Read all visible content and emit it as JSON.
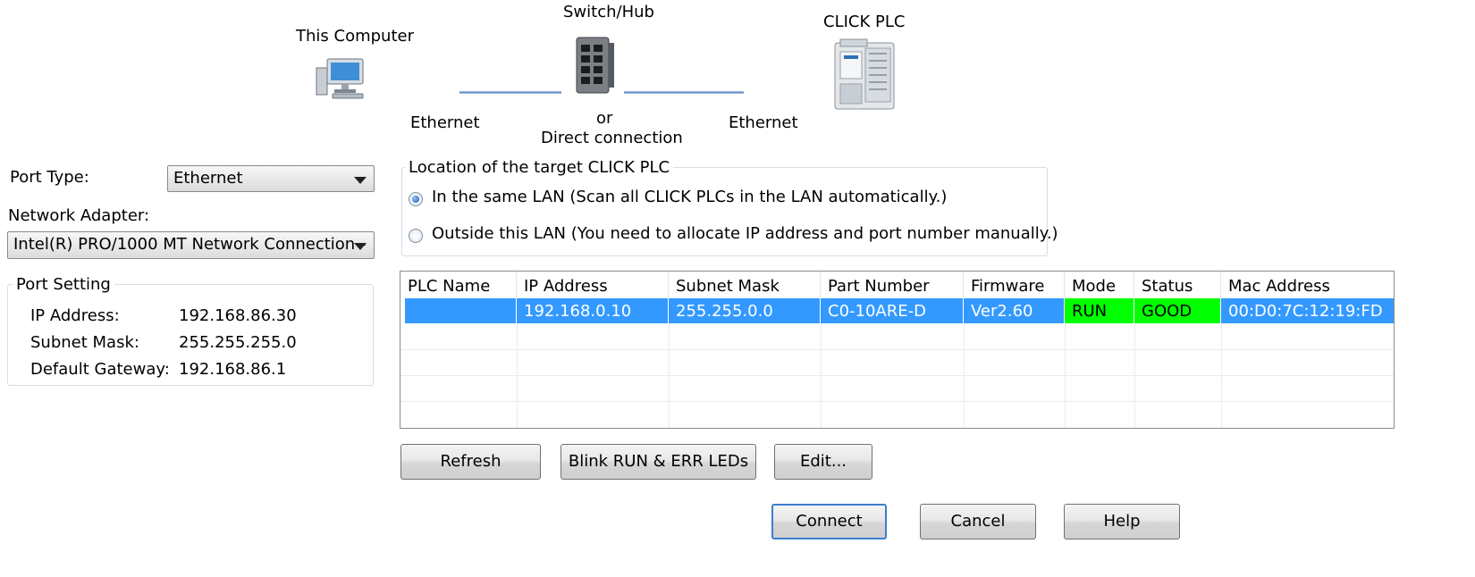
{
  "diagram": {
    "computer_label": "This Computer",
    "switch_label": "Switch/Hub",
    "plc_label": "CLICK PLC",
    "ethernet_left": "Ethernet",
    "ethernet_right": "Ethernet",
    "or_label": "or",
    "direct_label": "Direct connection"
  },
  "port": {
    "type_label": "Port Type:",
    "type_value": "Ethernet",
    "adapter_label": "Network Adapter:",
    "adapter_value": "Intel(R) PRO/1000 MT Network Connection -"
  },
  "port_setting": {
    "title": "Port Setting",
    "ip_label": "IP Address:",
    "ip_value": "192.168.86.30",
    "mask_label": "Subnet Mask:",
    "mask_value": "255.255.255.0",
    "gateway_label": "Default Gateway:",
    "gateway_value": "192.168.86.1"
  },
  "location": {
    "title": "Location of the target CLICK PLC",
    "option_same_lan": "In the same LAN (Scan all CLICK PLCs in the LAN automatically.)",
    "option_outside_lan": "Outside this LAN (You need to allocate IP address and port number manually.)",
    "selected": "same_lan"
  },
  "plc_table": {
    "headers": [
      "PLC Name",
      "IP Address",
      "Subnet Mask",
      "Part Number",
      "Firmware",
      "Mode",
      "Status",
      "Mac Address"
    ],
    "rows": [
      {
        "plc_name": "",
        "ip_address": "192.168.0.10",
        "subnet_mask": "255.255.0.0",
        "part_number": "C0-10ARE-D",
        "firmware": "Ver2.60",
        "mode": "RUN",
        "status": "GOOD",
        "mac_address": "00:D0:7C:12:19:FD"
      }
    ]
  },
  "actions": {
    "refresh": "Refresh",
    "blink": "Blink RUN & ERR LEDs",
    "edit": "Edit..."
  },
  "dialog_buttons": {
    "connect": "Connect",
    "cancel": "Cancel",
    "help": "Help"
  },
  "colors": {
    "selection": "#3399ff",
    "status_good": "#00ff00",
    "default_button_border": "#3a7fd0"
  }
}
